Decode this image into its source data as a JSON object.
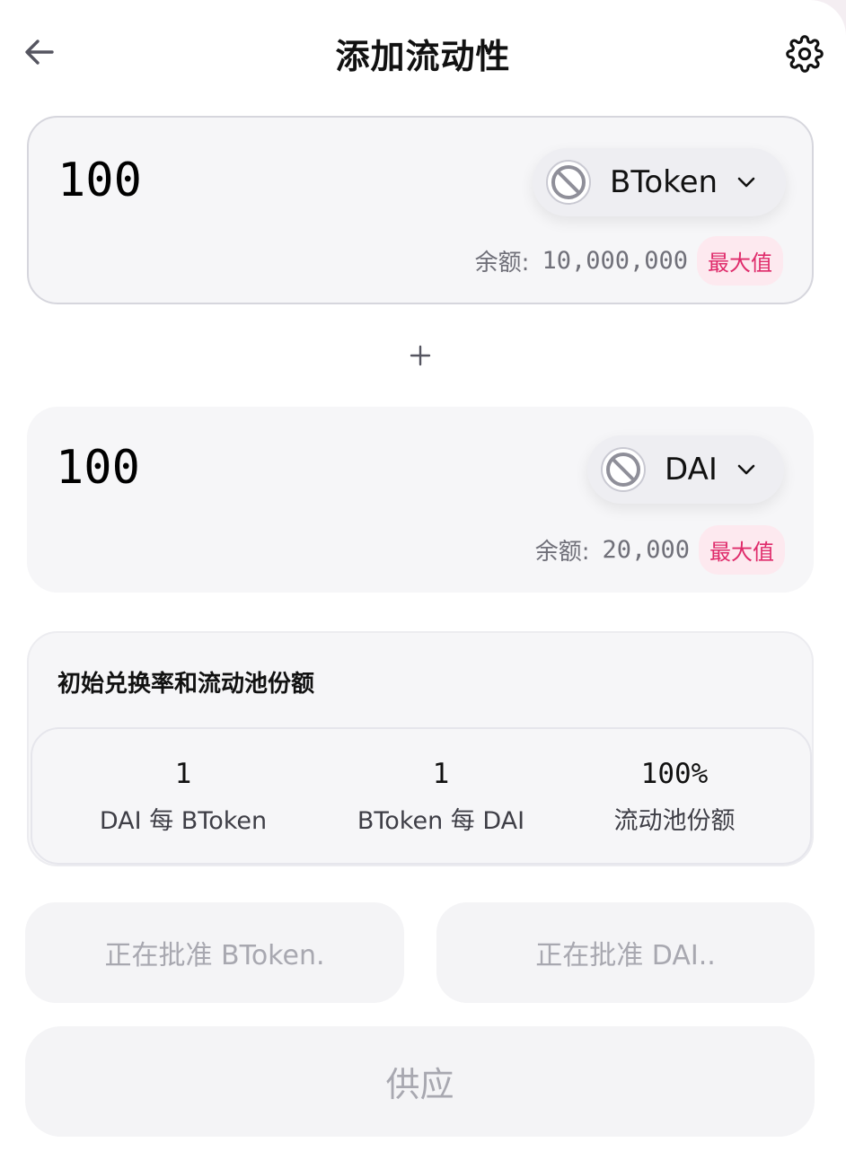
{
  "header": {
    "title": "添加流动性",
    "back_icon": "arrow-left-icon",
    "settings_icon": "gear-icon"
  },
  "token_a": {
    "amount": "100",
    "symbol": "BToken",
    "icon": "no-token-icon",
    "balance_label": "余额:",
    "balance_value": "10,000,000",
    "max_label": "最大值"
  },
  "plus_icon": "plus-icon",
  "token_b": {
    "amount": "100",
    "symbol": "DAI",
    "icon": "no-token-icon",
    "balance_label": "余额:",
    "balance_value": "20,000",
    "max_label": "最大值"
  },
  "rates": {
    "title": "初始兑换率和流动池份额",
    "items": [
      {
        "value": "1",
        "label": "DAI 每 BToken"
      },
      {
        "value": "1",
        "label": "BToken 每 DAI"
      },
      {
        "value": "100%",
        "label": "流动池份额"
      }
    ]
  },
  "actions": {
    "approve_a": "正在批准 BToken.",
    "approve_b": "正在批准 DAI..",
    "supply": "供应"
  },
  "colors": {
    "accent": "#df2a6a",
    "accent_bg": "#fde9ef",
    "panel_bg": "#f6f6f8",
    "disabled_text": "#a8a8b0"
  }
}
